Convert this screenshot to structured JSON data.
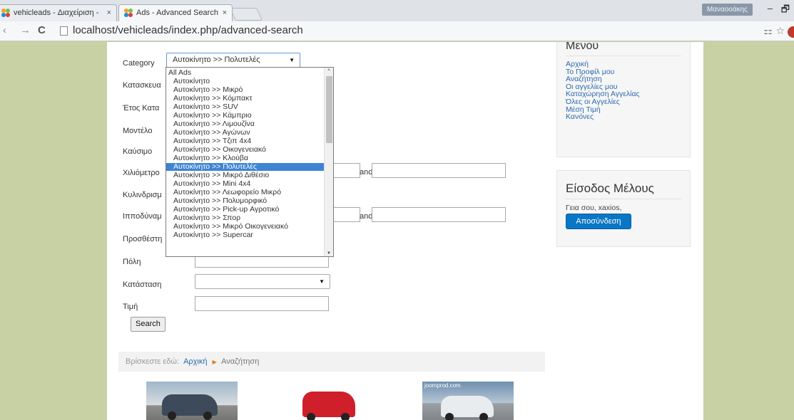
{
  "browser": {
    "tabs": [
      {
        "title": "vehicleads - Διαχείριση - ",
        "close": "×"
      },
      {
        "title": "Ads - Advanced Search",
        "close": "×"
      }
    ],
    "user_badge": "Μαναοοάκης",
    "window_controls": {
      "minimize": "–",
      "maximize": "🗗"
    },
    "nav": {
      "back": "‹",
      "forward": "→",
      "reload": "C"
    },
    "url": "localhost/vehicleads/index.php/advanced-search"
  },
  "form": {
    "labels": {
      "category": "Category",
      "manufacturer": "Κατασκευα",
      "year": "Έτος Κατα",
      "model": "Μοντέλο",
      "fuel": "Καύσιμο",
      "mileage": "Χιλιόμετρο",
      "cc": "Κυλινδρισμ",
      "hp": "Ιπποδύναμ",
      "added": "Προσθέστη",
      "city": "Πόλη",
      "condition": "Κατάσταση",
      "price": "Τιμή"
    },
    "category_selected": "Αυτοκίνητο >> Πολυτελές",
    "and_label": "and",
    "search_button": "Search"
  },
  "dropdown": {
    "options": [
      "All Ads",
      "Αυτοκίνητο",
      "Αυτοκίνητο >> Μικρό",
      "Αυτοκίνητο >> Κόμπακτ",
      "Αυτοκίνητο >> SUV",
      "Αυτοκίνητο >> Κάμπριο",
      "Αυτοκίνητο >> Λιμουζίνα",
      "Αυτοκίνητο >> Αγώνων",
      "Αυτοκίνητο >> Τζιπ 4x4",
      "Αυτοκίνητο >> Οικογενειακό",
      "Αυτοκίνητο >> Κλούβα",
      "Αυτοκίνητο >> Πολυτελές",
      "Αυτοκίνητο >> Μικρό Διθέσιο",
      "Αυτοκίνητο >> Mini 4x4",
      "Αυτοκίνητο >> Λεωφορείο Μικρό",
      "Αυτοκίνητο >> Πολυμορφικό",
      "Αυτοκίνητο >> Pick-up Αγροτικό",
      "Αυτοκίνητο >> Σπορ",
      "Αυτοκίνητο >> Μικρό Οικογενειακό",
      "Αυτοκίνητο >> Supercar"
    ],
    "selected_index": 11
  },
  "breadcrumb": {
    "prefix": "Βρίσκεστε εδώ:",
    "home": "Αρχική",
    "current": "Αναζήτηση"
  },
  "thumbnails": {
    "watermark": "joomprod.com"
  },
  "sidebar": {
    "menu_title": "Μενού",
    "menu_items": [
      "Αρχική",
      "Το Προφίλ μου",
      "Αναζήτηση",
      "Οι αγγελίες μου",
      "Καταχώρηση Αγγελίας",
      "Όλες οι Αγγελίες",
      "Μέση Τιμή",
      "Κανόνες"
    ],
    "login_title": "Είσοδος Μέλους",
    "greeting": "Γεια σου, xaxios,",
    "logout_button": "Αποσύνδεση"
  },
  "colors": {
    "page_background": "#c8d1a4",
    "link": "#2b6aad",
    "selected_option": "#3e84d4",
    "logout_button": "#0a76c6"
  }
}
